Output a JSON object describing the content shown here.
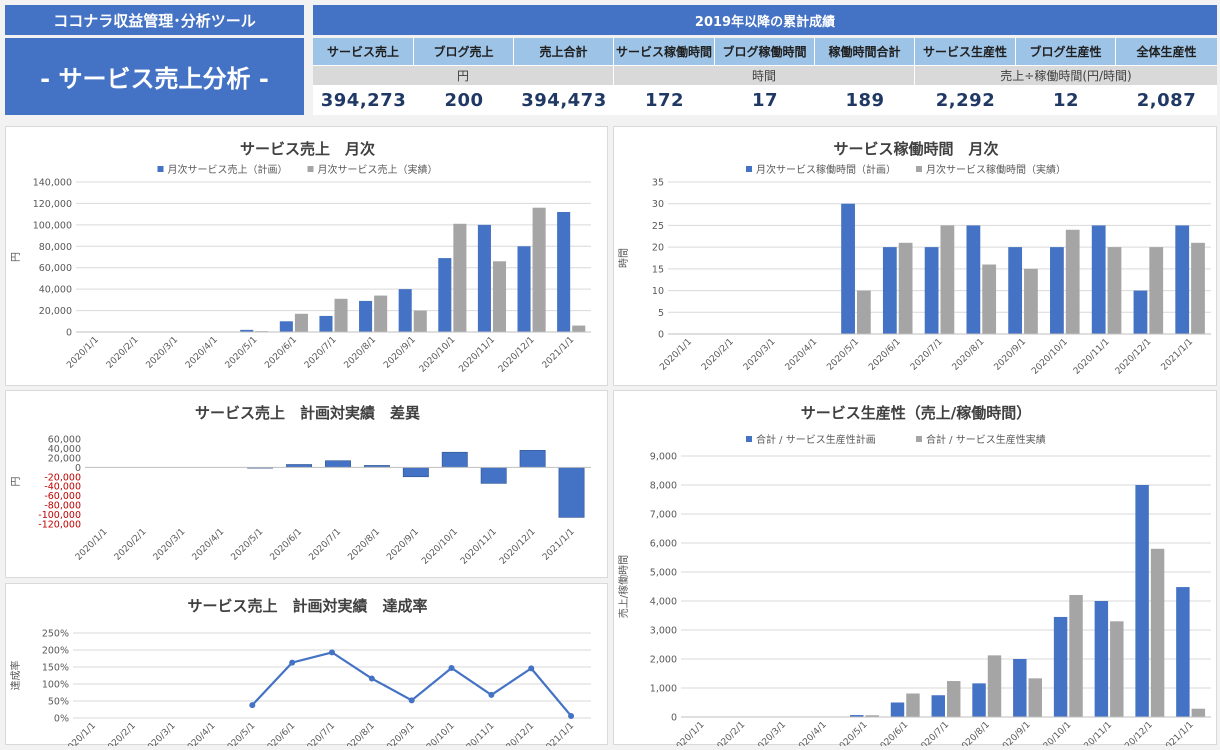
{
  "header": {
    "app_title": "ココナラ収益管理･分析ツール",
    "page_title": "- サービス売上分析 -",
    "summary_title": "2019年以降の累計成績",
    "metrics": [
      {
        "label": "サービス売上",
        "value": "394,273"
      },
      {
        "label": "ブログ売上",
        "value": "200"
      },
      {
        "label": "売上合計",
        "value": "394,473"
      },
      {
        "label": "サービス稼働時間",
        "value": "172"
      },
      {
        "label": "ブログ稼働時間",
        "value": "17"
      },
      {
        "label": "稼働時間合計",
        "value": "189"
      },
      {
        "label": "サービス生産性",
        "value": "2,292"
      },
      {
        "label": "ブログ生産性",
        "value": "12"
      },
      {
        "label": "全体生産性",
        "value": "2,087"
      }
    ],
    "units": [
      "円",
      "時間",
      "売上÷稼働時間(円/時間)"
    ]
  },
  "colors": {
    "accent": "#4472c4",
    "plan": "#4472c4",
    "actual": "#a5a5a5",
    "negative": "#c00000"
  },
  "chart_data": [
    {
      "id": "sales",
      "type": "bar",
      "title": "サービス売上　月次",
      "ylabel": "円",
      "categories": [
        "2020/1/1",
        "2020/2/1",
        "2020/3/1",
        "2020/4/1",
        "2020/5/1",
        "2020/6/1",
        "2020/7/1",
        "2020/8/1",
        "2020/9/1",
        "2020/10/1",
        "2020/11/1",
        "2020/12/1",
        "2021/1/1"
      ],
      "series": [
        {
          "name": "月次サービス売上（計画）",
          "values": [
            0,
            0,
            0,
            0,
            2000,
            10000,
            15000,
            29000,
            40000,
            69000,
            100000,
            80000,
            112000
          ]
        },
        {
          "name": "月次サービス売上（実績）",
          "values": [
            0,
            0,
            0,
            0,
            800,
            17000,
            31000,
            34000,
            20000,
            101000,
            66000,
            116000,
            6000
          ]
        }
      ],
      "ylim": [
        0,
        140000
      ],
      "yticks": [
        0,
        20000,
        40000,
        60000,
        80000,
        100000,
        120000,
        140000
      ],
      "ytick_labels": [
        "0",
        "20,000",
        "40,000",
        "60,000",
        "80,000",
        "100,000",
        "120,000",
        "140,000"
      ]
    },
    {
      "id": "hours",
      "type": "bar",
      "title": "サービス稼働時間　月次",
      "ylabel": "時間",
      "categories": [
        "2020/1/1",
        "2020/2/1",
        "2020/3/1",
        "2020/4/1",
        "2020/5/1",
        "2020/6/1",
        "2020/7/1",
        "2020/8/1",
        "2020/9/1",
        "2020/10/1",
        "2020/11/1",
        "2020/12/1",
        "2021/1/1"
      ],
      "series": [
        {
          "name": "月次サービス稼働時間（計画）",
          "values": [
            0,
            0,
            0,
            0,
            30,
            20,
            20,
            25,
            20,
            20,
            25,
            10,
            25
          ]
        },
        {
          "name": "月次サービス稼働時間（実績）",
          "values": [
            0,
            0,
            0,
            0,
            10,
            21,
            25,
            16,
            15,
            24,
            20,
            20,
            21
          ]
        }
      ],
      "ylim": [
        0,
        35
      ],
      "yticks": [
        0,
        5,
        10,
        15,
        20,
        25,
        30,
        35
      ],
      "ytick_labels": [
        "0",
        "5",
        "10",
        "15",
        "20",
        "25",
        "30",
        "35"
      ]
    },
    {
      "id": "diff",
      "type": "bar",
      "title": "サービス売上　計画対実績　差異",
      "ylabel": "円",
      "categories": [
        "2020/1/1",
        "2020/2/1",
        "2020/3/1",
        "2020/4/1",
        "2020/5/1",
        "2020/6/1",
        "2020/7/1",
        "2020/8/1",
        "2020/9/1",
        "2020/10/1",
        "2020/11/1",
        "2020/12/1",
        "2021/1/1"
      ],
      "series": [
        {
          "values": [
            0,
            0,
            0,
            0,
            -1200,
            6000,
            14000,
            4000,
            -20000,
            32000,
            -34000,
            36000,
            -106000
          ]
        }
      ],
      "ylim": [
        -120000,
        60000
      ],
      "yticks": [
        60000,
        40000,
        20000,
        0,
        -20000,
        -40000,
        -60000,
        -80000,
        -100000,
        -120000
      ],
      "ytick_labels": [
        "60,000",
        "40,000",
        "20,000",
        "0",
        "-20,000",
        "-40,000",
        "-60,000",
        "-80,000",
        "-100,000",
        "-120,000"
      ]
    },
    {
      "id": "rate",
      "type": "line",
      "title": "サービス売上　計画対実績　達成率",
      "ylabel": "達成率",
      "categories": [
        "2020/1/1",
        "2020/2/1",
        "2020/3/1",
        "2020/4/1",
        "2020/5/1",
        "2020/6/1",
        "2020/7/1",
        "2020/8/1",
        "2020/9/1",
        "2020/10/1",
        "2020/11/1",
        "2020/12/1",
        "2021/1/1"
      ],
      "series": [
        {
          "values": [
            null,
            null,
            null,
            null,
            38,
            163,
            193,
            116,
            52,
            147,
            68,
            146,
            6
          ]
        }
      ],
      "ylim": [
        0,
        250
      ],
      "yticks": [
        0,
        50,
        100,
        150,
        200,
        250
      ],
      "ytick_labels": [
        "0%",
        "50%",
        "100%",
        "150%",
        "200%",
        "250%"
      ]
    },
    {
      "id": "prod",
      "type": "bar",
      "title": "サービス生産性（売上/稼働時間）",
      "ylabel": "売上/稼働時間",
      "categories": [
        "2020/1/1",
        "2020/2/1",
        "2020/3/1",
        "2020/4/1",
        "2020/5/1",
        "2020/6/1",
        "2020/7/1",
        "2020/8/1",
        "2020/9/1",
        "2020/10/1",
        "2020/11/1",
        "2020/12/1",
        "2021/1/1"
      ],
      "series": [
        {
          "name": "合計 / サービス生産性計画",
          "values": [
            0,
            0,
            0,
            0,
            67,
            500,
            750,
            1160,
            2000,
            3450,
            4000,
            8000,
            4480
          ]
        },
        {
          "name": "合計 / サービス生産性実績",
          "values": [
            0,
            0,
            0,
            0,
            60,
            810,
            1240,
            2125,
            1333,
            4208,
            3300,
            5800,
            286
          ]
        }
      ],
      "ylim": [
        0,
        9000
      ],
      "yticks": [
        0,
        1000,
        2000,
        3000,
        4000,
        5000,
        6000,
        7000,
        8000,
        9000
      ],
      "ytick_labels": [
        "0",
        "1,000",
        "2,000",
        "3,000",
        "4,000",
        "5,000",
        "6,000",
        "7,000",
        "8,000",
        "9,000"
      ]
    }
  ]
}
